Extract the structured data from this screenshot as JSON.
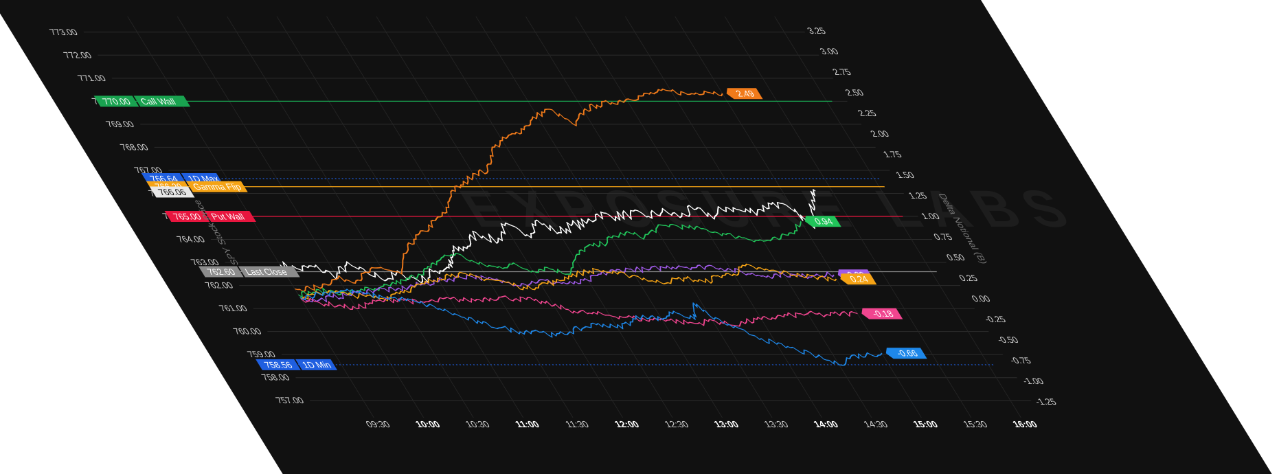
{
  "chart_data": {
    "type": "line",
    "watermark": "EXPOSURE LABS",
    "xlabel": "",
    "ylabel": "SPY Stock Price",
    "y2label": "Delta Notional (B)",
    "x_ticks": [
      {
        "label": "09:30",
        "t": 570,
        "bold": false
      },
      {
        "label": "10:00",
        "t": 600,
        "bold": true
      },
      {
        "label": "10:30",
        "t": 630,
        "bold": false
      },
      {
        "label": "11:00",
        "t": 660,
        "bold": true
      },
      {
        "label": "11:30",
        "t": 690,
        "bold": false
      },
      {
        "label": "12:00",
        "t": 720,
        "bold": true
      },
      {
        "label": "12:30",
        "t": 750,
        "bold": false
      },
      {
        "label": "13:00",
        "t": 780,
        "bold": true
      },
      {
        "label": "13:30",
        "t": 810,
        "bold": false
      },
      {
        "label": "14:00",
        "t": 840,
        "bold": true
      },
      {
        "label": "14:30",
        "t": 870,
        "bold": false
      },
      {
        "label": "15:00",
        "t": 900,
        "bold": true
      },
      {
        "label": "15:30",
        "t": 930,
        "bold": false
      },
      {
        "label": "16:00",
        "t": 960,
        "bold": true
      }
    ],
    "y_ticks": [
      "757.00",
      "758.00",
      "759.00",
      "760.00",
      "761.00",
      "762.00",
      "763.00",
      "764.00",
      "765.00",
      "766.00",
      "767.00",
      "768.00",
      "769.00",
      "770.00",
      "771.00",
      "772.00",
      "773.00"
    ],
    "y_tick_values": [
      757,
      758,
      759,
      760,
      761,
      762,
      763,
      764,
      765,
      766,
      767,
      768,
      769,
      770,
      771,
      772,
      773
    ],
    "y2_ticks": [
      "-1.25",
      "-1.00",
      "-0.75",
      "-0.50",
      "-0.25",
      "0.00",
      "0.25",
      "0.50",
      "0.75",
      "1.00",
      "1.25",
      "1.50",
      "1.75",
      "2.00",
      "2.25",
      "2.50",
      "2.75",
      "3.00",
      "3.25"
    ],
    "y2_tick_values": [
      -1.25,
      -1.0,
      -0.75,
      -0.5,
      -0.25,
      0,
      0.25,
      0.5,
      0.75,
      1.0,
      1.25,
      1.5,
      1.75,
      2.0,
      2.25,
      2.5,
      2.75,
      3.0,
      3.25
    ],
    "ylim": [
      756.5,
      773.5
    ],
    "y2lim": [
      -1.375,
      3.375
    ],
    "levels": [
      {
        "value": 770.0,
        "value_label": "770.00",
        "name": "Call Wall",
        "color": "#19a350",
        "line": "solid"
      },
      {
        "value": 766.64,
        "value_label": "766.64",
        "name": "1D Max",
        "color": "#1f5fe0",
        "line": "dotted"
      },
      {
        "value": 766.29,
        "value_label": "766.29",
        "name": "Gamma Flip",
        "color": "#f5a315",
        "line": "solid"
      },
      {
        "value": 766.06,
        "value_label": "766.06",
        "name": "",
        "color": "#e8e8e8",
        "line": "none"
      },
      {
        "value": 765.0,
        "value_label": "765.00",
        "name": "Put Wall",
        "color": "#e8163f",
        "line": "solid"
      },
      {
        "value": 762.6,
        "value_label": "762.60",
        "name": "Last Close",
        "color": "#8c8c8c",
        "line": "solid"
      },
      {
        "value": 758.56,
        "value_label": "758.56",
        "name": "1D Min",
        "color": "#1f5fe0",
        "line": "dotted"
      }
    ],
    "series": [
      {
        "axis": "price",
        "color": "#ffffff",
        "end_label": "",
        "width": 1.6,
        "points": [
          [
            570,
            762.9
          ],
          [
            580,
            762.7
          ],
          [
            590,
            762.8
          ],
          [
            600,
            762.4
          ],
          [
            610,
            762.9
          ],
          [
            620,
            762.5
          ],
          [
            630,
            762.3
          ],
          [
            640,
            762.5
          ],
          [
            650,
            762.2
          ],
          [
            660,
            762.6
          ],
          [
            670,
            762.8
          ],
          [
            675,
            763.0
          ],
          [
            680,
            763.5
          ],
          [
            690,
            763.7
          ],
          [
            700,
            764.3
          ],
          [
            710,
            763.9
          ],
          [
            720,
            764.6
          ],
          [
            730,
            764.2
          ],
          [
            740,
            764.8
          ],
          [
            750,
            764.3
          ],
          [
            760,
            764.6
          ],
          [
            770,
            764.7
          ],
          [
            780,
            765.1
          ],
          [
            790,
            765.0
          ],
          [
            800,
            765.1
          ],
          [
            810,
            765.0
          ],
          [
            820,
            765.2
          ],
          [
            830,
            765.0
          ],
          [
            840,
            765.3
          ],
          [
            850,
            765.0
          ],
          [
            860,
            765.4
          ],
          [
            870,
            765.2
          ],
          [
            880,
            765.3
          ],
          [
            890,
            765.6
          ],
          [
            900,
            765.2
          ],
          [
            905,
            764.6
          ],
          [
            910,
            765.2
          ],
          [
            915,
            765.7
          ],
          [
            920,
            766.1
          ]
        ]
      },
      {
        "axis": "delta",
        "color": "#f07a1a",
        "end_label": "2.49",
        "width": 1.6,
        "points": [
          [
            570,
            0.12
          ],
          [
            580,
            0.12
          ],
          [
            590,
            0.18
          ],
          [
            600,
            0.25
          ],
          [
            610,
            0.22
          ],
          [
            620,
            0.32
          ],
          [
            630,
            0.38
          ],
          [
            640,
            0.3
          ],
          [
            650,
            0.55
          ],
          [
            660,
            0.72
          ],
          [
            670,
            0.82
          ],
          [
            680,
            0.95
          ],
          [
            690,
            1.05
          ],
          [
            700,
            1.3
          ],
          [
            710,
            1.38
          ],
          [
            720,
            1.52
          ],
          [
            730,
            1.55
          ],
          [
            740,
            1.8
          ],
          [
            750,
            1.92
          ],
          [
            760,
            2.0
          ],
          [
            770,
            2.1
          ],
          [
            780,
            2.22
          ],
          [
            790,
            2.3
          ],
          [
            800,
            2.1
          ],
          [
            810,
            2.28
          ],
          [
            820,
            2.35
          ],
          [
            830,
            2.38
          ],
          [
            840,
            2.42
          ],
          [
            850,
            2.46
          ],
          [
            860,
            2.5
          ],
          [
            870,
            2.52
          ],
          [
            880,
            2.48
          ],
          [
            890,
            2.52
          ],
          [
            900,
            2.49
          ]
        ]
      },
      {
        "axis": "delta",
        "color": "#21c45a",
        "end_label": "0.94",
        "width": 1.5,
        "points": [
          [
            570,
            0.05
          ],
          [
            580,
            0.08
          ],
          [
            590,
            0.1
          ],
          [
            600,
            0.06
          ],
          [
            610,
            0.12
          ],
          [
            620,
            0.1
          ],
          [
            630,
            0.18
          ],
          [
            640,
            0.22
          ],
          [
            650,
            0.3
          ],
          [
            660,
            0.38
          ],
          [
            670,
            0.5
          ],
          [
            680,
            0.55
          ],
          [
            690,
            0.42
          ],
          [
            700,
            0.38
          ],
          [
            710,
            0.42
          ],
          [
            720,
            0.34
          ],
          [
            730,
            0.38
          ],
          [
            740,
            0.3
          ],
          [
            750,
            0.48
          ],
          [
            760,
            0.62
          ],
          [
            770,
            0.65
          ],
          [
            780,
            0.74
          ],
          [
            790,
            0.8
          ],
          [
            800,
            0.75
          ],
          [
            810,
            0.85
          ],
          [
            820,
            0.9
          ],
          [
            830,
            0.86
          ],
          [
            840,
            0.84
          ],
          [
            850,
            0.78
          ],
          [
            860,
            0.74
          ],
          [
            870,
            0.7
          ],
          [
            880,
            0.72
          ],
          [
            890,
            0.8
          ],
          [
            900,
            0.94
          ]
        ]
      },
      {
        "axis": "delta",
        "color": "#a05ae8",
        "end_label": "0.29",
        "width": 1.5,
        "points": [
          [
            570,
            0.0
          ],
          [
            580,
            -0.02
          ],
          [
            590,
            0.02
          ],
          [
            600,
            0.05
          ],
          [
            610,
            0.08
          ],
          [
            620,
            0.12
          ],
          [
            630,
            0.1
          ],
          [
            640,
            0.15
          ],
          [
            650,
            0.18
          ],
          [
            660,
            0.22
          ],
          [
            670,
            0.25
          ],
          [
            680,
            0.28
          ],
          [
            690,
            0.24
          ],
          [
            700,
            0.2
          ],
          [
            710,
            0.18
          ],
          [
            720,
            0.22
          ],
          [
            730,
            0.2
          ],
          [
            740,
            0.18
          ],
          [
            750,
            0.22
          ],
          [
            760,
            0.3
          ],
          [
            770,
            0.34
          ],
          [
            780,
            0.36
          ],
          [
            790,
            0.35
          ],
          [
            800,
            0.38
          ],
          [
            810,
            0.4
          ],
          [
            820,
            0.38
          ],
          [
            830,
            0.4
          ],
          [
            840,
            0.35
          ],
          [
            850,
            0.3
          ],
          [
            860,
            0.28
          ],
          [
            870,
            0.3
          ],
          [
            880,
            0.27
          ],
          [
            890,
            0.3
          ],
          [
            900,
            0.29
          ]
        ]
      },
      {
        "axis": "delta",
        "color": "#f5a315",
        "end_label": "0.24",
        "width": 1.5,
        "points": [
          [
            570,
            0.0
          ],
          [
            580,
            0.05
          ],
          [
            590,
            0.1
          ],
          [
            600,
            0.05
          ],
          [
            610,
            0.03
          ],
          [
            620,
            0.0
          ],
          [
            630,
            0.08
          ],
          [
            640,
            0.12
          ],
          [
            650,
            0.18
          ],
          [
            660,
            0.25
          ],
          [
            670,
            0.3
          ],
          [
            680,
            0.28
          ],
          [
            690,
            0.24
          ],
          [
            700,
            0.2
          ],
          [
            710,
            0.12
          ],
          [
            720,
            0.18
          ],
          [
            730,
            0.2
          ],
          [
            740,
            0.28
          ],
          [
            750,
            0.32
          ],
          [
            760,
            0.35
          ],
          [
            770,
            0.3
          ],
          [
            780,
            0.28
          ],
          [
            790,
            0.2
          ],
          [
            800,
            0.22
          ],
          [
            810,
            0.25
          ],
          [
            820,
            0.2
          ],
          [
            830,
            0.28
          ],
          [
            840,
            0.3
          ],
          [
            850,
            0.4
          ],
          [
            860,
            0.35
          ],
          [
            870,
            0.32
          ],
          [
            880,
            0.28
          ],
          [
            890,
            0.26
          ],
          [
            900,
            0.24
          ]
        ]
      },
      {
        "axis": "delta",
        "color": "#f0458f",
        "end_label": "-0.18",
        "width": 1.5,
        "points": [
          [
            570,
            0.0
          ],
          [
            580,
            -0.05
          ],
          [
            590,
            -0.08
          ],
          [
            600,
            -0.12
          ],
          [
            610,
            -0.05
          ],
          [
            620,
            -0.02
          ],
          [
            630,
            0.0
          ],
          [
            640,
            -0.05
          ],
          [
            650,
            -0.03
          ],
          [
            660,
            0.0
          ],
          [
            670,
            -0.02
          ],
          [
            680,
            0.0
          ],
          [
            690,
            0.02
          ],
          [
            700,
            0.0
          ],
          [
            710,
            -0.02
          ],
          [
            720,
            -0.08
          ],
          [
            730,
            -0.15
          ],
          [
            740,
            -0.18
          ],
          [
            750,
            -0.2
          ],
          [
            760,
            -0.22
          ],
          [
            770,
            -0.26
          ],
          [
            780,
            -0.24
          ],
          [
            790,
            -0.28
          ],
          [
            800,
            -0.3
          ],
          [
            810,
            -0.26
          ],
          [
            820,
            -0.32
          ],
          [
            830,
            -0.28
          ],
          [
            840,
            -0.25
          ],
          [
            850,
            -0.22
          ],
          [
            860,
            -0.2
          ],
          [
            870,
            -0.18
          ],
          [
            880,
            -0.2
          ],
          [
            890,
            -0.18
          ],
          [
            900,
            -0.18
          ]
        ]
      },
      {
        "axis": "delta",
        "color": "#1e88ea",
        "end_label": "-0.66",
        "width": 1.5,
        "points": [
          [
            570,
            0.02
          ],
          [
            580,
            0.05
          ],
          [
            590,
            0.08
          ],
          [
            600,
            0.1
          ],
          [
            610,
            0.06
          ],
          [
            620,
            0.02
          ],
          [
            630,
            0.0
          ],
          [
            640,
            -0.05
          ],
          [
            650,
            -0.12
          ],
          [
            660,
            -0.22
          ],
          [
            670,
            -0.3
          ],
          [
            680,
            -0.35
          ],
          [
            690,
            -0.4
          ],
          [
            700,
            -0.38
          ],
          [
            710,
            -0.45
          ],
          [
            720,
            -0.4
          ],
          [
            730,
            -0.35
          ],
          [
            740,
            -0.3
          ],
          [
            750,
            -0.35
          ],
          [
            760,
            -0.28
          ],
          [
            770,
            -0.2
          ],
          [
            780,
            -0.25
          ],
          [
            790,
            -0.15
          ],
          [
            800,
            -0.25
          ],
          [
            805,
            -0.05
          ],
          [
            810,
            -0.2
          ],
          [
            820,
            -0.35
          ],
          [
            830,
            -0.45
          ],
          [
            840,
            -0.55
          ],
          [
            850,
            -0.62
          ],
          [
            860,
            -0.7
          ],
          [
            870,
            -0.8
          ],
          [
            880,
            -0.7
          ],
          [
            890,
            -0.68
          ],
          [
            900,
            -0.66
          ]
        ]
      }
    ]
  }
}
